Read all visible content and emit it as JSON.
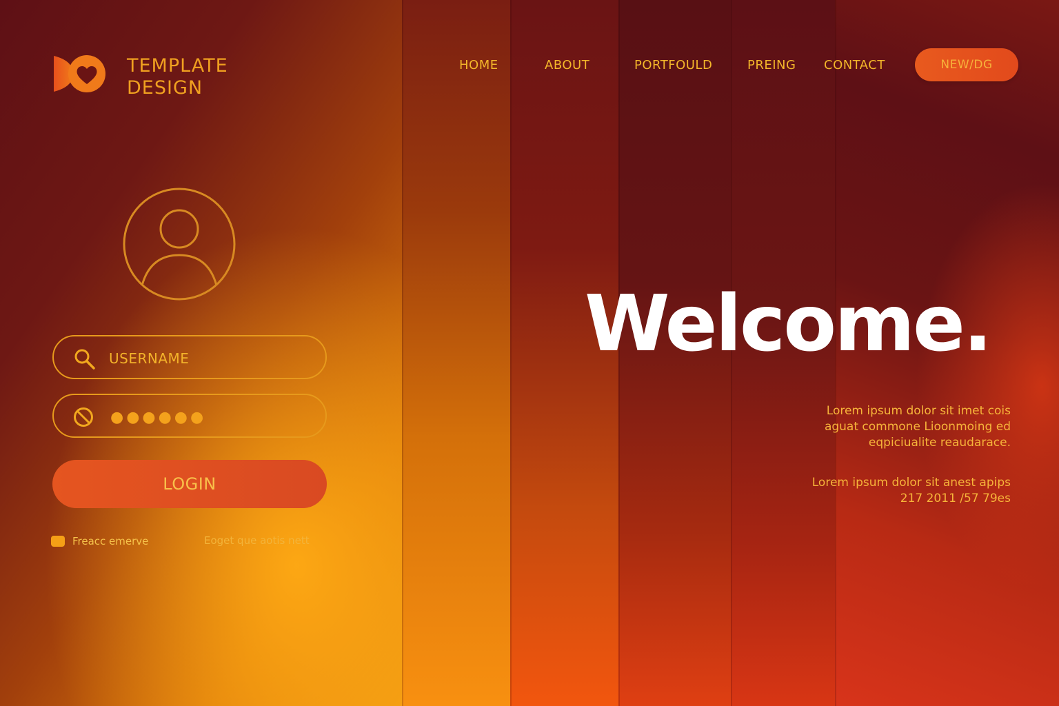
{
  "brand": {
    "line1": "TEMPLATE",
    "line2": "DESIGN",
    "logo_icon": "heart-logo-icon",
    "primary_color": "#e55520",
    "accent_color": "#f3b62a"
  },
  "nav": {
    "items": [
      {
        "label": "HOME"
      },
      {
        "label": "ABOUT"
      },
      {
        "label": "PORTFOULD"
      },
      {
        "label": "PREING"
      },
      {
        "label": "CONTACT"
      }
    ],
    "cta_label": "NEW/DG"
  },
  "login": {
    "avatar_icon": "user-avatar-icon",
    "username_placeholder": "USERNAME",
    "username_icon": "search-icon",
    "password_icon": "lock-icon",
    "password_mask": "●●●●●●",
    "button_label": "LOGIN",
    "remember_label": "Freacc emerve",
    "forgot_label": "Eoget que aotis nett"
  },
  "hero": {
    "title": "Welcome.",
    "paragraph1": [
      "Lorem ipsum dolor sit imet cois",
      "aguat commone Lioonmoing ed",
      "eqpiciualite reaudarace."
    ],
    "paragraph2": [
      "Lorem ipsum dolor sit anest apips",
      "217 2011 /57 79es"
    ]
  }
}
